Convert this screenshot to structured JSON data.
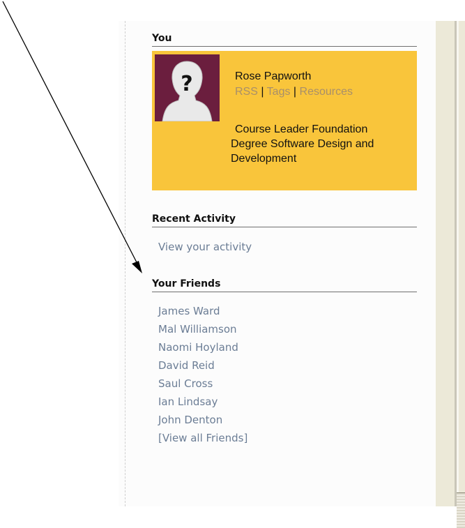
{
  "you_section": {
    "heading": "You",
    "name": "Rose Papworth",
    "links": [
      "RSS",
      "Tags",
      "Resources"
    ],
    "separator": "|",
    "bio_line1": "Course Leader Foundation",
    "bio_line2": "Degree Software Design and",
    "bio_line3": "Development",
    "avatar_icon": "unknown-user-silhouette-icon",
    "box_color": "#f9c53b"
  },
  "recent_activity": {
    "heading": "Recent Activity",
    "link": "View your activity"
  },
  "friends": {
    "heading": "Your Friends",
    "items": [
      "James Ward",
      "Mal Williamson",
      "Naomi Hoyland",
      "David Reid",
      "Saul Cross",
      "Ian Lindsay",
      "John Denton"
    ],
    "view_all": "[View all Friends]"
  },
  "link_color": "#6b7d95",
  "annotation": {
    "icon": "arrow-icon"
  }
}
